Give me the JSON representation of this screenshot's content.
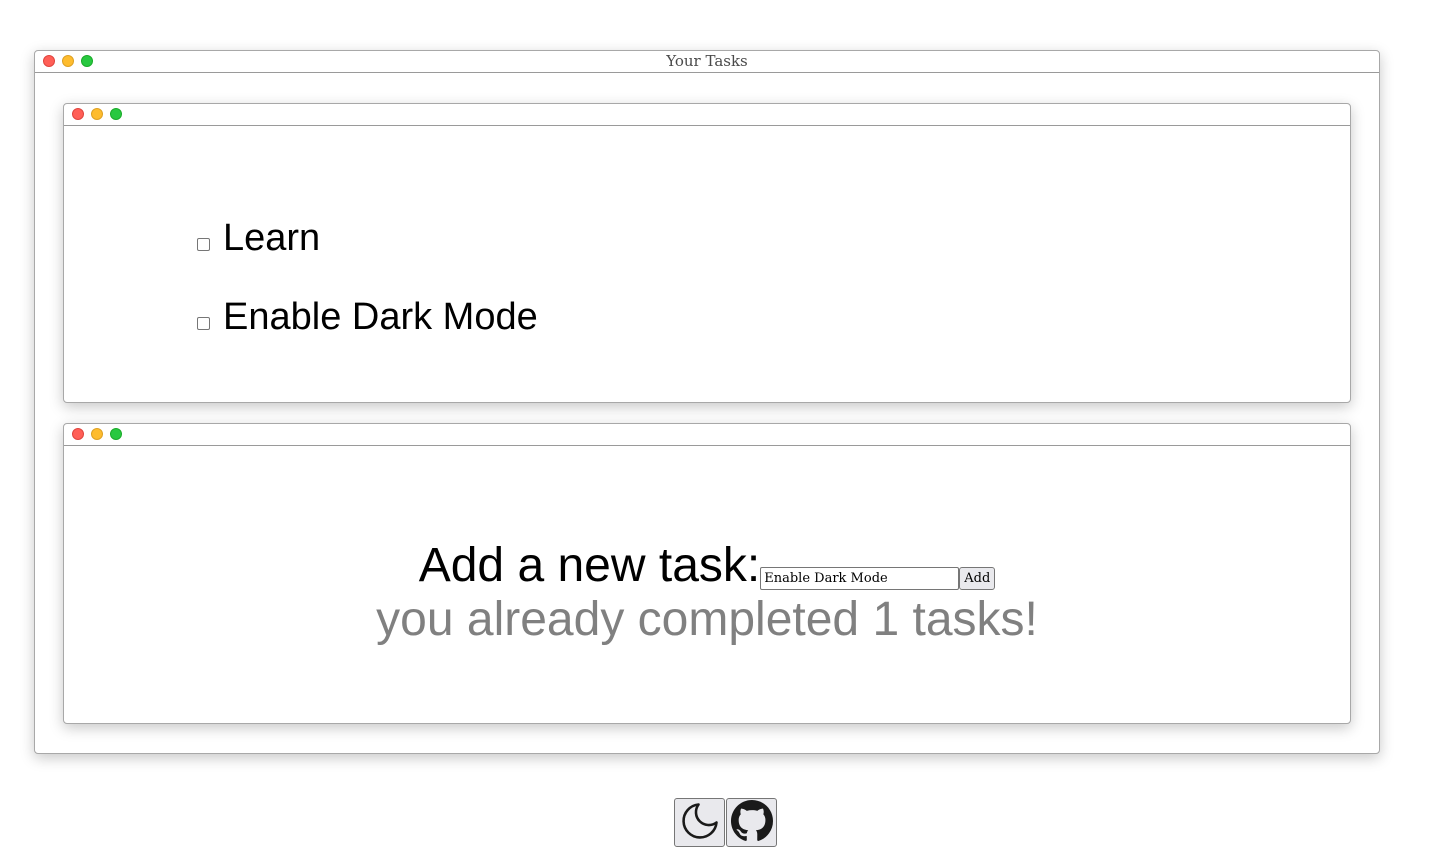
{
  "window": {
    "title": "Your Tasks"
  },
  "tasks": {
    "items": [
      {
        "label": "Learn",
        "checked": false
      },
      {
        "label": "Enable Dark Mode",
        "checked": false
      }
    ]
  },
  "add_task": {
    "label": "Add a new task:",
    "input_value": "Enable Dark Mode",
    "button_label": "Add",
    "completed_message": "you already completed 1 tasks!"
  },
  "footer": {
    "icons": [
      "moon-icon",
      "github-icon"
    ]
  },
  "colors": {
    "traffic_red": "#ff5f57",
    "traffic_yellow": "#febc2e",
    "traffic_green": "#28c840",
    "muted_text": "#808080"
  }
}
